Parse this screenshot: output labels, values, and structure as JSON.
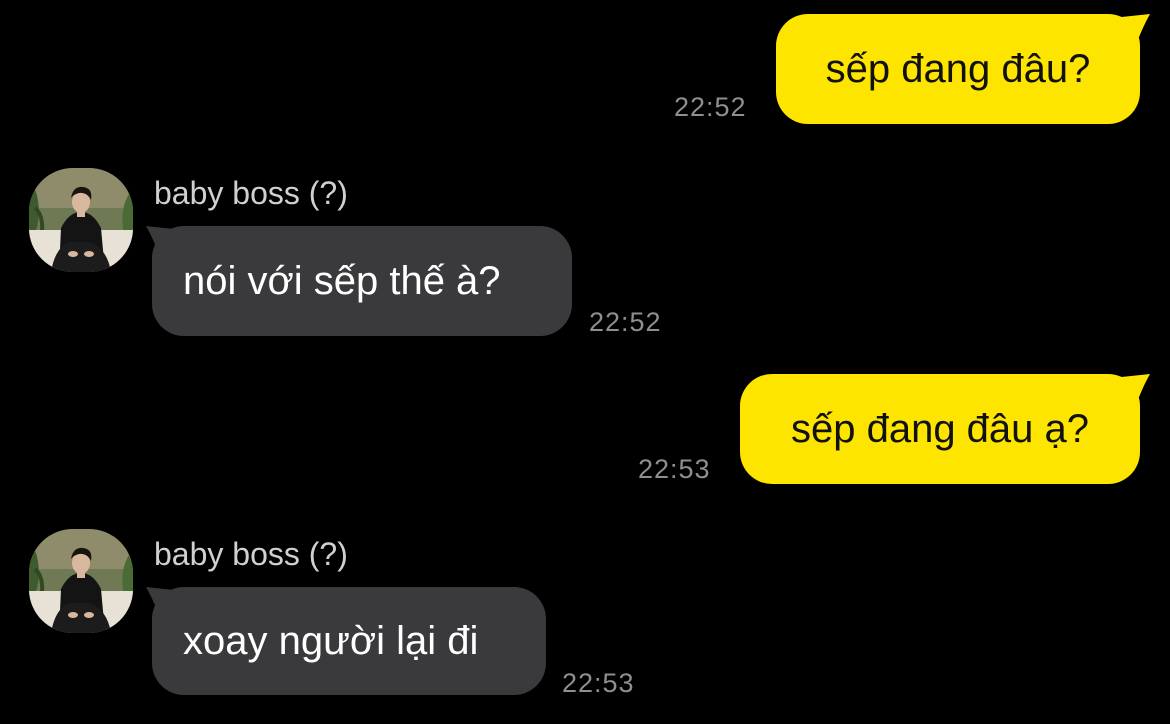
{
  "theme": {
    "background": "#000000",
    "outgoing_bubble": "#FEE500",
    "incoming_bubble": "#3A3A3C",
    "timestamp_color": "#8E8E93"
  },
  "messages": [
    {
      "direction": "outgoing",
      "text": "sếp đang đâu?",
      "time": "22:52"
    },
    {
      "direction": "incoming",
      "sender": "baby boss (?)",
      "avatar_icon": "profile-photo-avatar",
      "text": "nói với sếp thế à?",
      "time": "22:52"
    },
    {
      "direction": "outgoing",
      "text": "sếp đang đâu ạ?",
      "time": "22:53"
    },
    {
      "direction": "incoming",
      "sender": "baby boss (?)",
      "avatar_icon": "profile-photo-avatar",
      "text": "xoay người lại đi",
      "time": "22:53"
    }
  ]
}
